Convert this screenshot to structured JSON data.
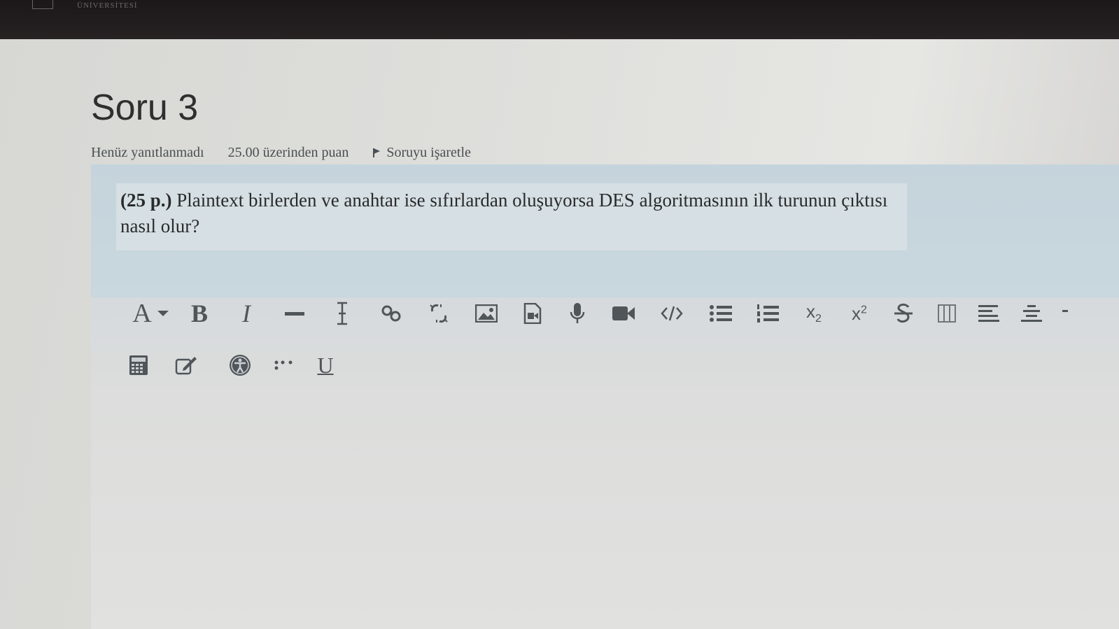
{
  "header": {
    "brand": "ÜNİVERSİTESİ"
  },
  "question": {
    "title": "Soru 3",
    "status": "Henüz yanıtlanmadı",
    "score": "25.00 üzerinden puan",
    "flag_label": "Soruyu işaretle",
    "points_prefix": "(25 p.)",
    "text": " Plaintext birlerden ve anahtar ise sıfırlardan oluşuyorsa DES algoritmasının ilk turunun çıktısı nasıl olur?"
  },
  "toolbar": {
    "font_color": "A",
    "bold": "B",
    "italic": "I",
    "subscript_label": "x",
    "subscript_sub": "2",
    "superscript_label": "x",
    "superscript_sup": "2",
    "underline": "U",
    "icons": [
      "font-color-icon",
      "bold-icon",
      "italic-icon",
      "horizontal-rule-icon",
      "clear-formatting-icon",
      "link-icon",
      "unlink-icon",
      "image-icon",
      "media-icon",
      "microphone-icon",
      "video-icon",
      "html-icon",
      "unordered-list-icon",
      "ordered-list-icon",
      "subscript-icon",
      "superscript-icon",
      "strikethrough-icon",
      "table-column-icon",
      "align-left-icon",
      "align-center-icon",
      "equation-icon",
      "edit-icon",
      "accessibility-icon",
      "special-chars-icon",
      "underline-icon"
    ]
  }
}
